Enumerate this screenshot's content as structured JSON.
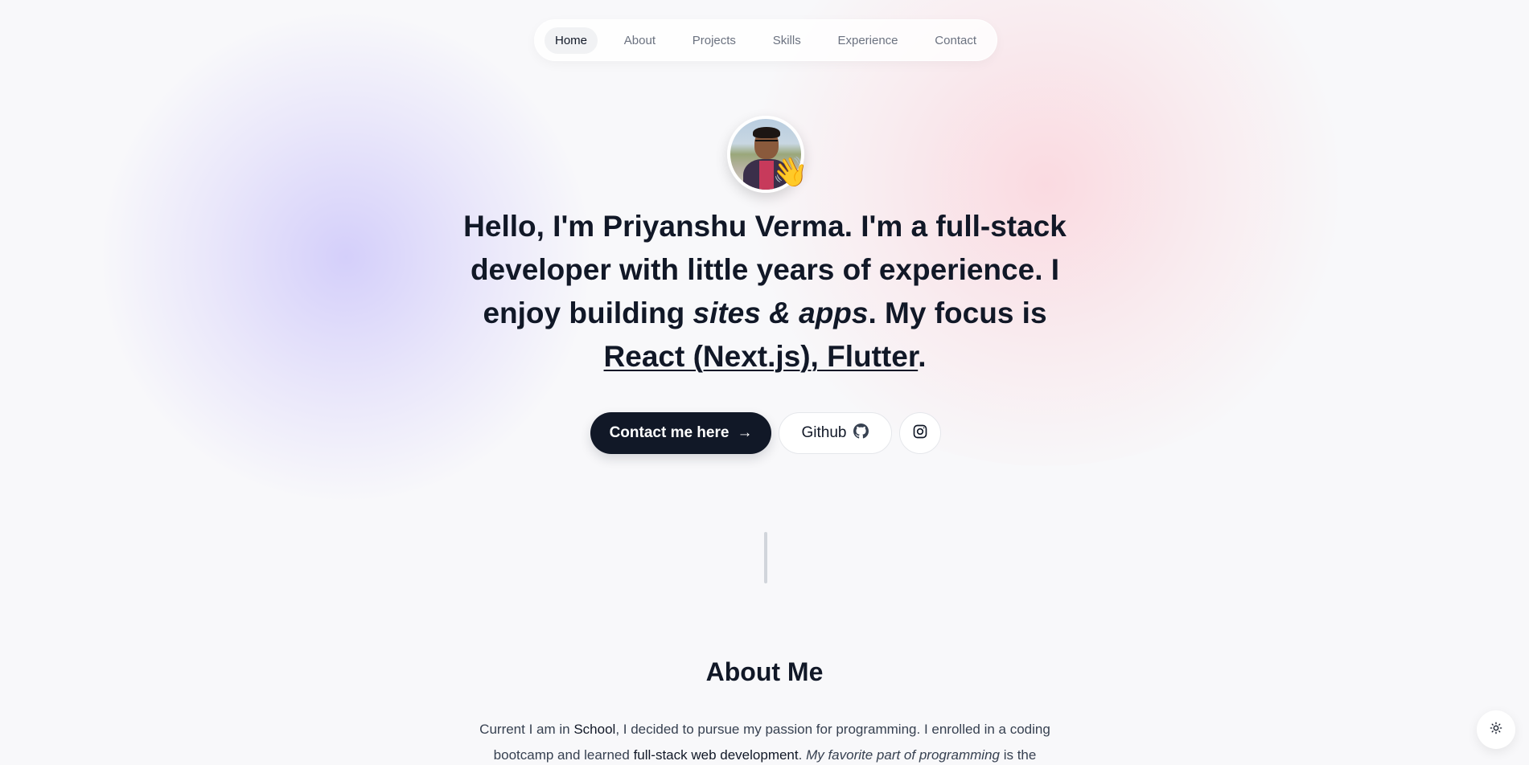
{
  "nav": {
    "items": [
      {
        "label": "Home",
        "active": true
      },
      {
        "label": "About"
      },
      {
        "label": "Projects"
      },
      {
        "label": "Skills"
      },
      {
        "label": "Experience"
      },
      {
        "label": "Contact"
      }
    ]
  },
  "hero": {
    "avatar_emoji": "👋",
    "intro_bold": "Hello, I'm Priyanshu Verma.",
    "t1": " I'm a ",
    "role_bold": "full-stack developer",
    "t2": " with ",
    "years_bold": "little years",
    "t3": " of experience. I enjoy building ",
    "build_italic": "sites & apps",
    "t4": ". My focus is ",
    "focus_underline": "React (Next.js), Flutter",
    "t5": "."
  },
  "buttons": {
    "contact_label": "Contact me here",
    "contact_icon": "→",
    "github_label": "Github"
  },
  "about": {
    "title": "About Me",
    "p1": "Current I am in ",
    "p1_em": "School",
    "p2": ", I decided to pursue my passion for programming. I enrolled in a coding bootcamp and learned ",
    "p2_em": "full-stack web development",
    "p3": ". ",
    "p3_it": "My favorite part of programming",
    "p4": " is the"
  },
  "colors": {
    "primary": "#111827",
    "accent_purple": "#cec8fa",
    "accent_pink": "#fad7de"
  }
}
